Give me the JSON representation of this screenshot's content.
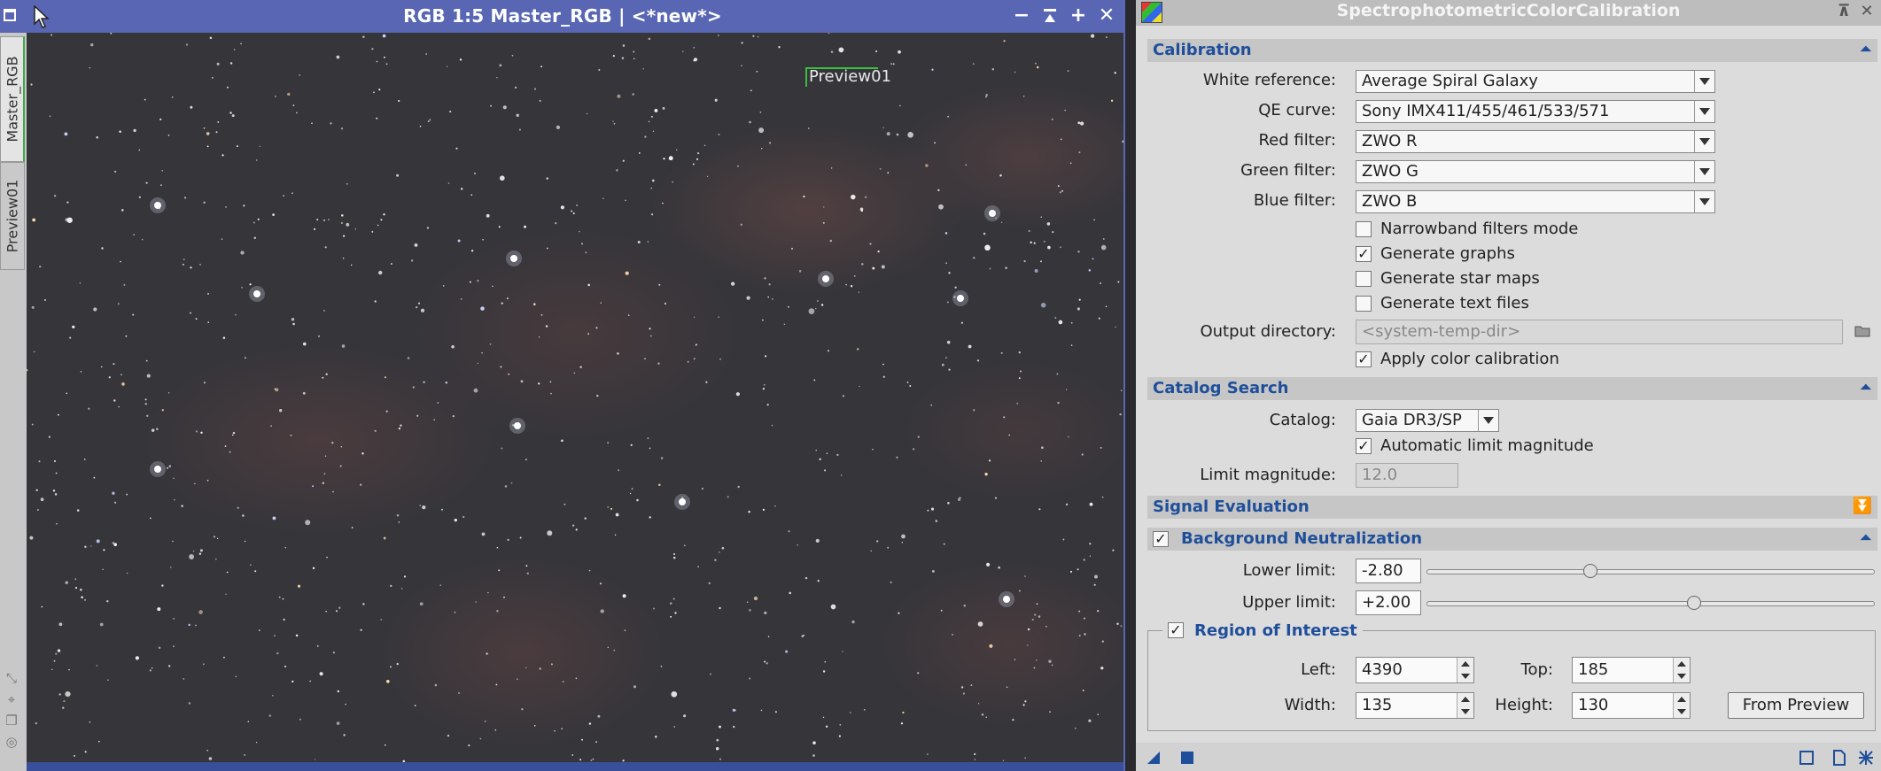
{
  "image_window": {
    "title": "RGB 1:5 Master_RGB | <*new*>",
    "tabs": [
      "Master_RGB",
      "Preview01"
    ],
    "preview_label": "Preview01",
    "colors": {
      "titlebar": "#5866b3",
      "preview_outline": "#39c03f"
    }
  },
  "panel": {
    "title": "SpectrophotometricColorCalibration",
    "calibration": {
      "section_title": "Calibration",
      "white_reference_label": "White reference:",
      "white_reference_value": "Average Spiral Galaxy",
      "qe_curve_label": "QE curve:",
      "qe_curve_value": "Sony IMX411/455/461/533/571",
      "red_filter_label": "Red filter:",
      "red_filter_value": "ZWO R",
      "green_filter_label": "Green filter:",
      "green_filter_value": "ZWO G",
      "blue_filter_label": "Blue filter:",
      "blue_filter_value": "ZWO B",
      "narrowband_label": "Narrowband filters mode",
      "narrowband_checked": false,
      "generate_graphs_label": "Generate graphs",
      "generate_graphs_checked": true,
      "generate_star_maps_label": "Generate star maps",
      "generate_star_maps_checked": false,
      "generate_text_files_label": "Generate text files",
      "generate_text_files_checked": false,
      "output_directory_label": "Output directory:",
      "output_directory_placeholder": "<system-temp-dir>",
      "apply_color_label": "Apply color calibration",
      "apply_color_checked": true
    },
    "catalog_search": {
      "section_title": "Catalog Search",
      "catalog_label": "Catalog:",
      "catalog_value": "Gaia DR3/SP",
      "auto_limit_label": "Automatic limit magnitude",
      "auto_limit_checked": true,
      "limit_magnitude_label": "Limit magnitude:",
      "limit_magnitude_value": "12.0"
    },
    "signal_evaluation": {
      "section_title": "Signal Evaluation"
    },
    "background_neutralization": {
      "section_title": "Background Neutralization",
      "enabled": true,
      "lower_limit_label": "Lower limit:",
      "lower_limit_value": "-2.80",
      "lower_limit_fraction": 0.36,
      "upper_limit_label": "Upper limit:",
      "upper_limit_value": "+2.00",
      "upper_limit_fraction": 0.6
    },
    "region_of_interest": {
      "section_title": "Region of Interest",
      "enabled": true,
      "left_label": "Left:",
      "left_value": "4390",
      "top_label": "Top:",
      "top_value": "185",
      "width_label": "Width:",
      "width_value": "135",
      "height_label": "Height:",
      "height_value": "130",
      "from_preview_label": "From Preview"
    },
    "icons": [
      "new-instance-icon",
      "apply-global-icon",
      "browse-docs-icon",
      "reset-icon",
      "preferences-icon",
      "folder-icon"
    ],
    "colors": {
      "section_title": "#1f4f9a",
      "panel_bg": "#dcdcdc"
    }
  }
}
